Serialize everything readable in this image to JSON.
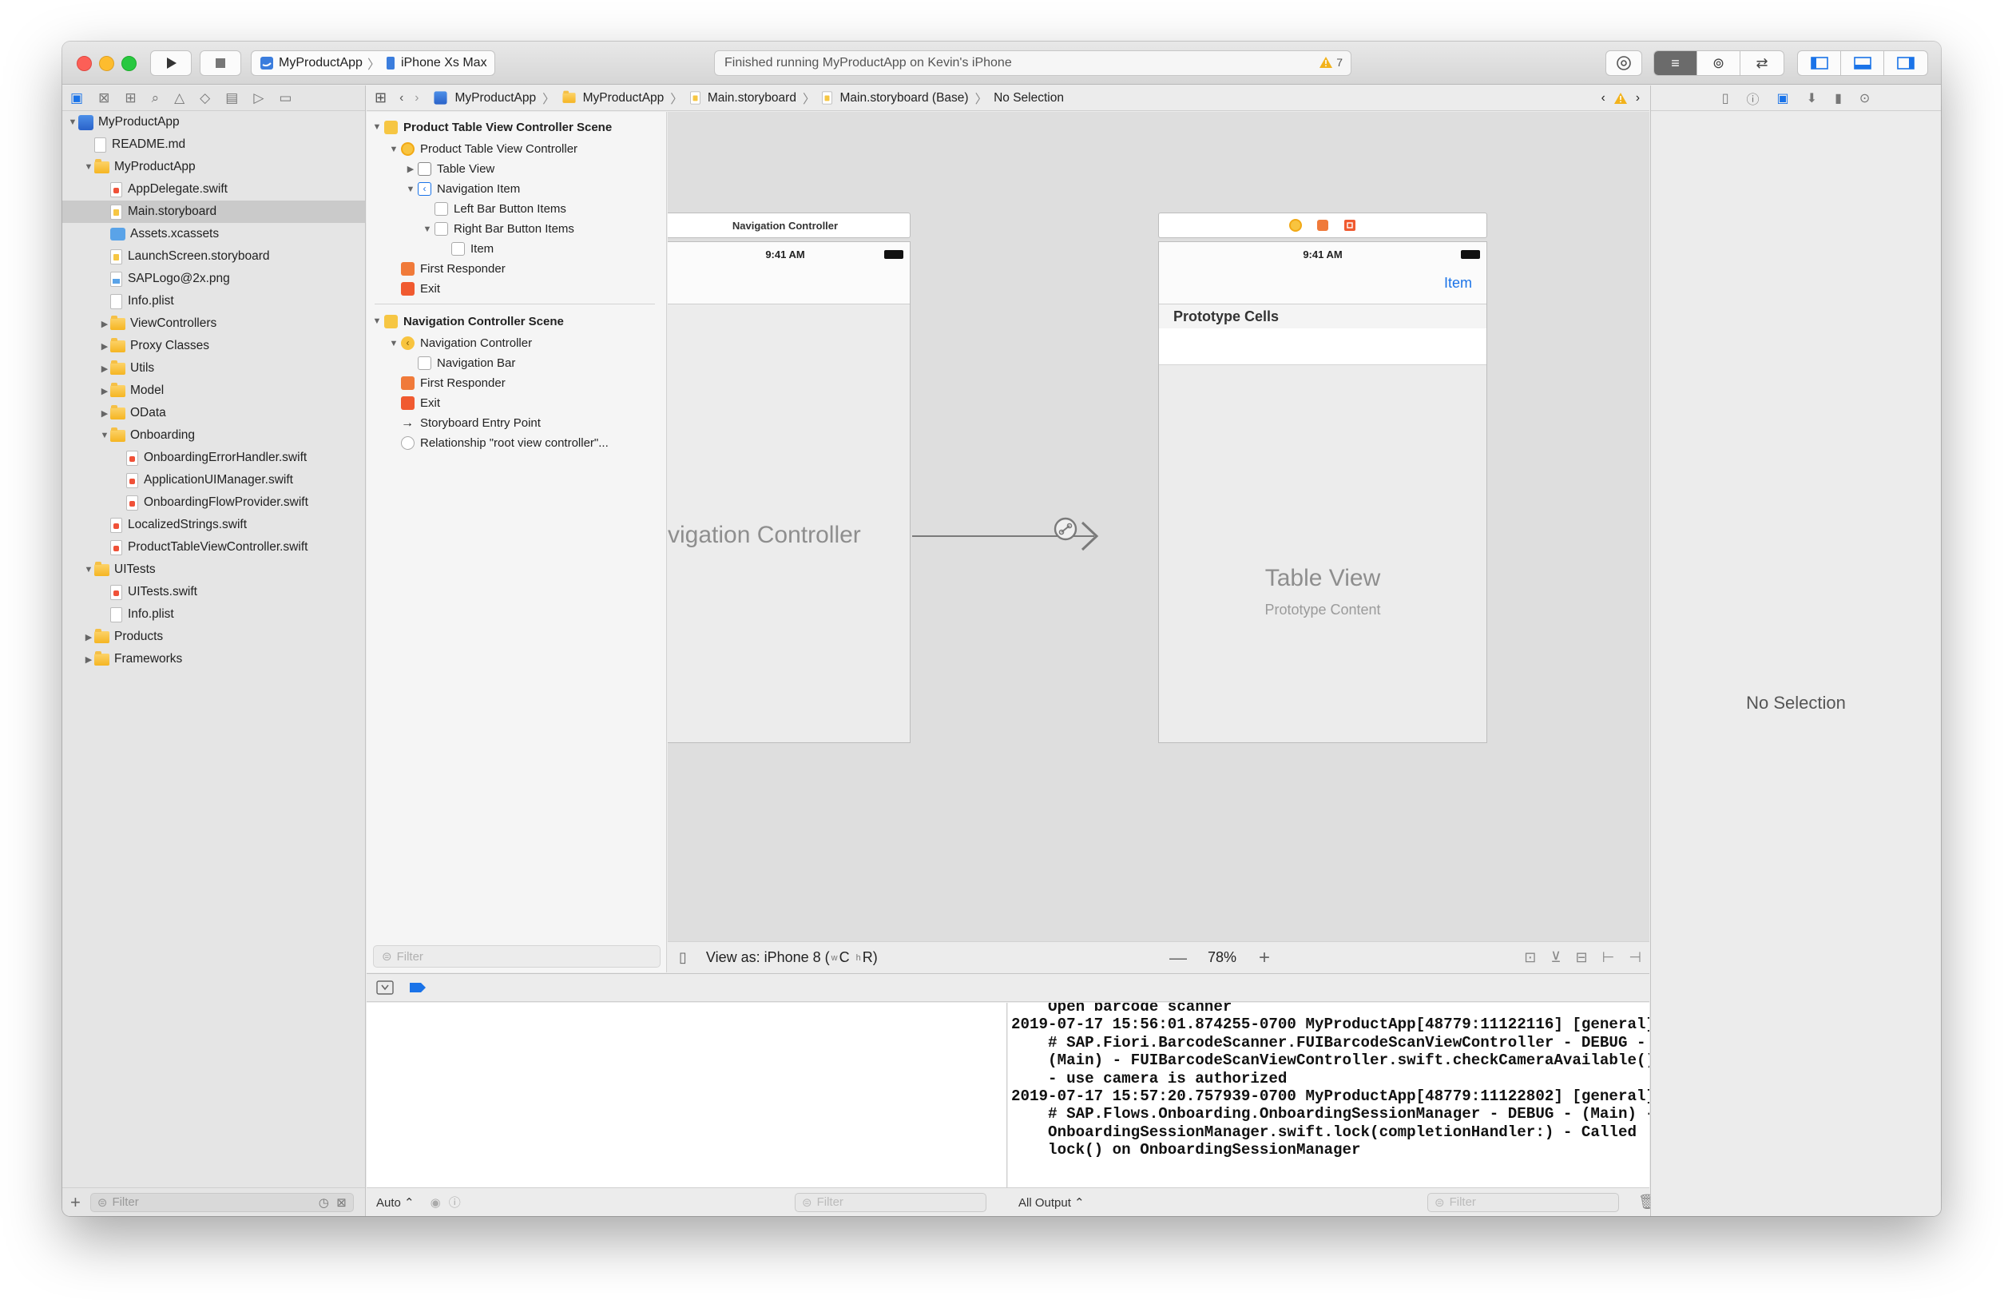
{
  "toolbar": {
    "scheme_target": "MyProductApp",
    "scheme_device": "iPhone Xs Max",
    "status_text": "Finished running MyProductApp on Kevin's iPhone",
    "warning_count": "7"
  },
  "navigator": {
    "tree": [
      {
        "label": "MyProductApp",
        "depth": 0,
        "kind": "project",
        "disclosure": "open"
      },
      {
        "label": "README.md",
        "depth": 1,
        "kind": "doc",
        "disclosure": ""
      },
      {
        "label": "MyProductApp",
        "depth": 1,
        "kind": "folder",
        "disclosure": "open"
      },
      {
        "label": "AppDelegate.swift",
        "depth": 2,
        "kind": "swift",
        "disclosure": ""
      },
      {
        "label": "Main.storyboard",
        "depth": 2,
        "kind": "story",
        "disclosure": "",
        "selected": true
      },
      {
        "label": "Assets.xcassets",
        "depth": 2,
        "kind": "assets",
        "disclosure": ""
      },
      {
        "label": "LaunchScreen.storyboard",
        "depth": 2,
        "kind": "story",
        "disclosure": ""
      },
      {
        "label": "SAPLogo@2x.png",
        "depth": 2,
        "kind": "png",
        "disclosure": ""
      },
      {
        "label": "Info.plist",
        "depth": 2,
        "kind": "doc",
        "disclosure": ""
      },
      {
        "label": "ViewControllers",
        "depth": 2,
        "kind": "folder",
        "disclosure": "closed"
      },
      {
        "label": "Proxy Classes",
        "depth": 2,
        "kind": "folder",
        "disclosure": "closed"
      },
      {
        "label": "Utils",
        "depth": 2,
        "kind": "folder",
        "disclosure": "closed"
      },
      {
        "label": "Model",
        "depth": 2,
        "kind": "folder",
        "disclosure": "closed"
      },
      {
        "label": "OData",
        "depth": 2,
        "kind": "folder",
        "disclosure": "closed"
      },
      {
        "label": "Onboarding",
        "depth": 2,
        "kind": "folder",
        "disclosure": "open"
      },
      {
        "label": "OnboardingErrorHandler.swift",
        "depth": 3,
        "kind": "swift",
        "disclosure": ""
      },
      {
        "label": "ApplicationUIManager.swift",
        "depth": 3,
        "kind": "swift",
        "disclosure": ""
      },
      {
        "label": "OnboardingFlowProvider.swift",
        "depth": 3,
        "kind": "swift",
        "disclosure": ""
      },
      {
        "label": "LocalizedStrings.swift",
        "depth": 2,
        "kind": "swift",
        "disclosure": ""
      },
      {
        "label": "ProductTableViewController.swift",
        "depth": 2,
        "kind": "swift",
        "disclosure": ""
      },
      {
        "label": "UITests",
        "depth": 1,
        "kind": "folder",
        "disclosure": "open"
      },
      {
        "label": "UITests.swift",
        "depth": 2,
        "kind": "swift",
        "disclosure": ""
      },
      {
        "label": "Info.plist",
        "depth": 2,
        "kind": "doc",
        "disclosure": ""
      },
      {
        "label": "Products",
        "depth": 1,
        "kind": "folder",
        "disclosure": "closed"
      },
      {
        "label": "Frameworks",
        "depth": 1,
        "kind": "folder",
        "disclosure": "closed"
      }
    ],
    "filter_placeholder": "Filter"
  },
  "jumpbar": {
    "crumbs": [
      "MyProductApp",
      "MyProductApp",
      "Main.storyboard",
      "Main.storyboard (Base)",
      "No Selection"
    ]
  },
  "outline": {
    "rows": [
      {
        "label": "Product Table View Controller Scene",
        "depth": 0,
        "icon": "scene",
        "disclosure": "open",
        "scene": true
      },
      {
        "label": "Product Table View Controller",
        "depth": 1,
        "icon": "vc",
        "disclosure": "open"
      },
      {
        "label": "Table View",
        "depth": 2,
        "icon": "table",
        "disclosure": "closed"
      },
      {
        "label": "Navigation Item",
        "depth": 2,
        "icon": "navitem",
        "disclosure": "open"
      },
      {
        "label": "Left Bar Button Items",
        "depth": 3,
        "icon": "bar",
        "disclosure": ""
      },
      {
        "label": "Right Bar Button Items",
        "depth": 3,
        "icon": "bar",
        "disclosure": "open"
      },
      {
        "label": "Item",
        "depth": 4,
        "icon": "bar",
        "disclosure": ""
      },
      {
        "label": "First Responder",
        "depth": 1,
        "icon": "fr",
        "disclosure": ""
      },
      {
        "label": "Exit",
        "depth": 1,
        "icon": "exit",
        "disclosure": ""
      },
      {
        "divider": true
      },
      {
        "label": "Navigation Controller Scene",
        "depth": 0,
        "icon": "scene",
        "disclosure": "open",
        "scene": true
      },
      {
        "label": "Navigation Controller",
        "depth": 1,
        "icon": "navc",
        "disclosure": "open"
      },
      {
        "label": "Navigation Bar",
        "depth": 2,
        "icon": "bar",
        "disclosure": ""
      },
      {
        "label": "First Responder",
        "depth": 1,
        "icon": "fr",
        "disclosure": ""
      },
      {
        "label": "Exit",
        "depth": 1,
        "icon": "exit",
        "disclosure": ""
      },
      {
        "label": "Storyboard Entry Point",
        "depth": 1,
        "icon": "arrow",
        "disclosure": ""
      },
      {
        "label": "Relationship \"root view controller\"...",
        "depth": 1,
        "icon": "rel",
        "disclosure": ""
      }
    ],
    "filter_placeholder": "Filter"
  },
  "canvas": {
    "nav_scene_title": "Navigation Controller",
    "nav_time": "9:41 AM",
    "nav_big_label": "vigation Controller",
    "table_time": "9:41 AM",
    "table_item_button": "Item",
    "prototype_cells": "Prototype Cells",
    "table_view_label": "Table View",
    "prototype_content": "Prototype Content"
  },
  "canvas_bottom": {
    "view_as": "View as: iPhone 8 (",
    "view_as_suffix": "C",
    "view_as_r": "R)",
    "zoom": "78%"
  },
  "console": {
    "text": "    Open barcode scanner\n2019-07-17 15:56:01.874255-0700 MyProductApp[48779:11122116] [general]\n    # SAP.Fiori.BarcodeScanner.FUIBarcodeScanViewController - DEBUG -\n    (Main) - FUIBarcodeScanViewController.swift.checkCameraAvailable()\n    - use camera is authorized\n2019-07-17 15:57:20.757939-0700 MyProductApp[48779:11122802] [general]\n    # SAP.Flows.Onboarding.OnboardingSessionManager - DEBUG - (Main) -\n    OnboardingSessionManager.swift.lock(completionHandler:) - Called\n    lock() on OnboardingSessionManager"
  },
  "debug_footer": {
    "auto_label": "Auto",
    "vars_filter_placeholder": "Filter",
    "output_label": "All Output",
    "console_filter_placeholder": "Filter"
  },
  "inspector": {
    "no_selection": "No Selection"
  },
  "colors": {
    "accent": "#1a73e8",
    "folder": "#f5b522",
    "swift": "#f05138"
  }
}
